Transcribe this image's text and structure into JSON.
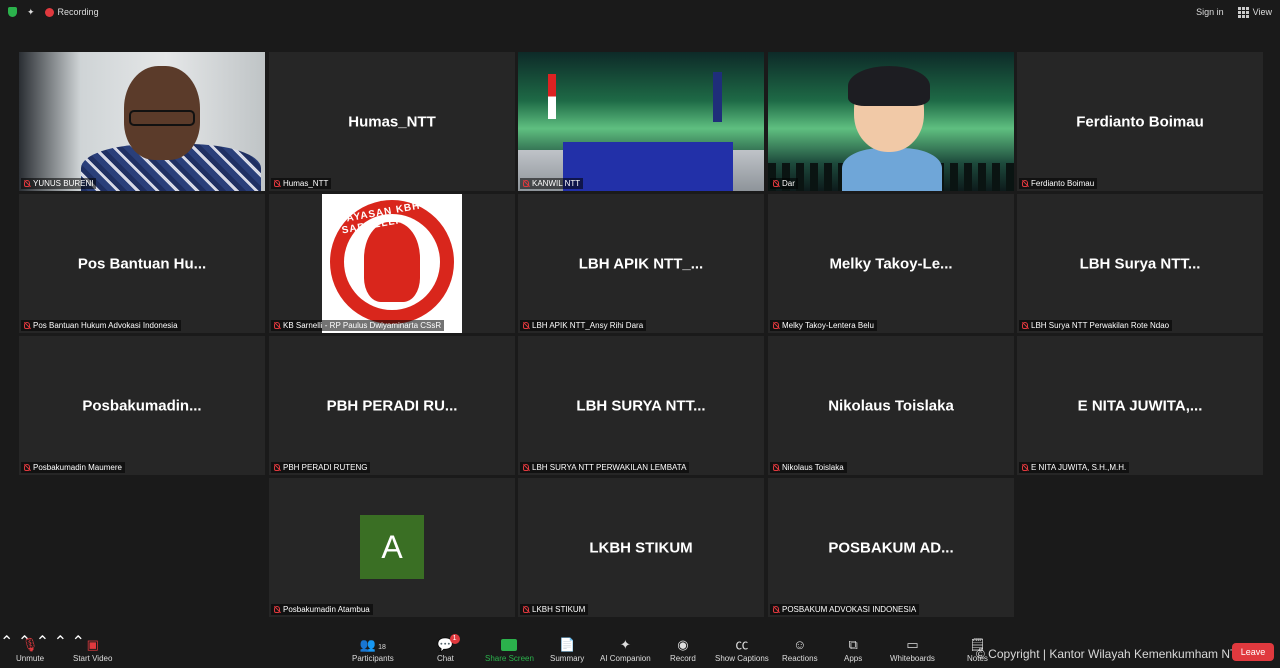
{
  "topbar": {
    "recording": "Recording",
    "sign_in": "Sign in",
    "view": "View"
  },
  "tiles": {
    "t1": {
      "label": "YUNUS BURENI"
    },
    "t2": {
      "name": "Humas_NTT",
      "label": "Humas_NTT"
    },
    "t3": {
      "label": "KANWIL NTT"
    },
    "t4": {
      "label": "Dar"
    },
    "t5": {
      "name": "Ferdianto Boimau",
      "label": "Ferdianto Boimau"
    },
    "t6": {
      "name": "Pos Bantuan Hu...",
      "label": "Pos Bantuan Hukum Advokasi Indonesia"
    },
    "t7": {
      "label": "KB Sarnelli - RP Paulus Dwiyaminarta CSsR",
      "logo_text": "YAYASAN KBH SARNELLI"
    },
    "t8": {
      "name": "LBH APIK NTT_...",
      "label": "LBH APIK NTT_Ansy Rihi Dara"
    },
    "t9": {
      "name": "Melky Takoy-Le...",
      "label": "Melky Takoy-Lentera Belu"
    },
    "t10": {
      "name": "LBH Surya NTT...",
      "label": "LBH Surya NTT Perwakilan Rote Ndao"
    },
    "t11": {
      "name": "Posbakumadin...",
      "label": "Posbakumadin Maumere"
    },
    "t12": {
      "name": "PBH PERADI RU...",
      "label": "PBH PERADI RUTENG"
    },
    "t13": {
      "name": "LBH SURYA NTT...",
      "label": "LBH SURYA NTT PERWAKILAN LEMBATA"
    },
    "t14": {
      "name": "Nikolaus Toislaka",
      "label": "Nikolaus Toislaka"
    },
    "t15": {
      "name": "E NITA JUWITA,...",
      "label": "E NITA JUWITA, S.H.,M.H."
    },
    "t16": {
      "initial": "A",
      "label": "Posbakumadin Atambua"
    },
    "t17": {
      "name": "LKBH STIKUM",
      "label": "LKBH STIKUM"
    },
    "t18": {
      "name": "POSBAKUM AD...",
      "label": "POSBAKUM ADVOKASI INDONESIA"
    }
  },
  "toolbar": {
    "unmute": "Unmute",
    "start_video": "Start Video",
    "participants": "Participants",
    "participants_count": "18",
    "chat": "Chat",
    "chat_badge": "1",
    "share_screen": "Share Screen",
    "summary": "Summary",
    "ai_companion": "AI Companion",
    "record": "Record",
    "show_captions": "Show Captions",
    "reactions": "Reactions",
    "apps": "Apps",
    "whiteboards": "Whiteboards",
    "notes": "Notes",
    "leave": "Leave"
  },
  "watermark": "© Copyright | Kantor Wilayah Kemenkumham NTT",
  "colors": {
    "active_speaker": "#c9e26e",
    "leave": "#e0393e",
    "share": "#2bb24c",
    "muted": "#e0393e"
  }
}
